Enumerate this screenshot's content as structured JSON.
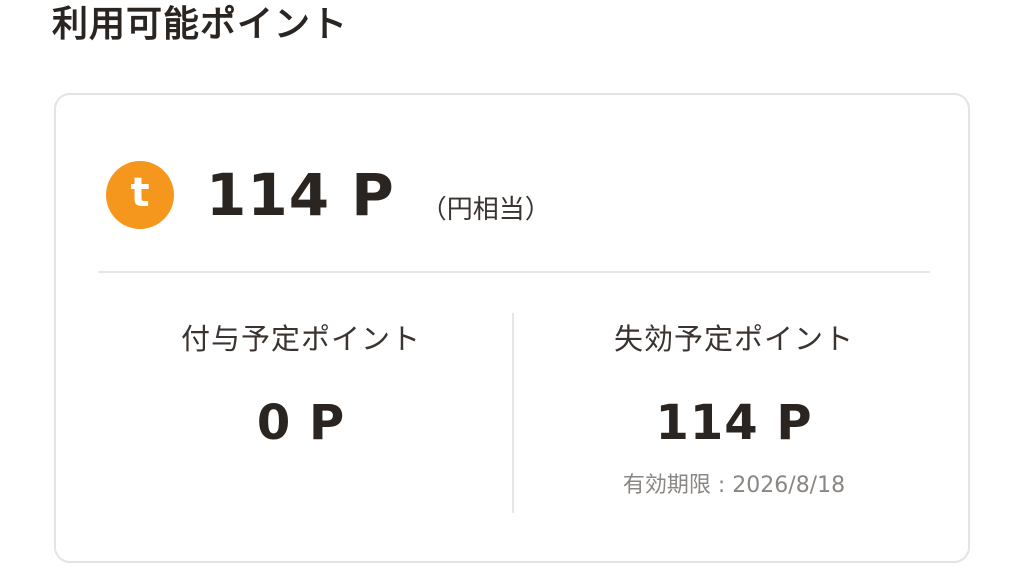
{
  "section": {
    "title": "利用可能ポイント"
  },
  "balance": {
    "icon": "t-point-coin-icon",
    "icon_letter": "t",
    "value": "114 P",
    "note": "（円相当）"
  },
  "scheduled_grant": {
    "label": "付与予定ポイント",
    "value": "0 P"
  },
  "scheduled_expiry": {
    "label": "失効予定ポイント",
    "value": "114 P",
    "expiry_text": "有効期限 : 2026/8/18"
  },
  "colors": {
    "accent": "#f5961d",
    "text": "#2b2522",
    "muted": "#8a8683",
    "border": "#e6e4e2"
  }
}
